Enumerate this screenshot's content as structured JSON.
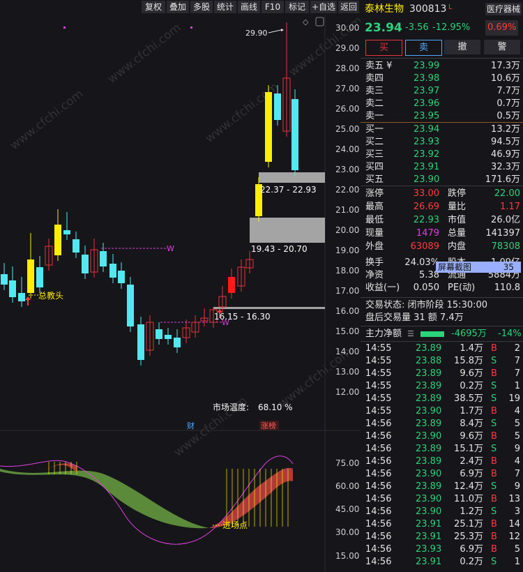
{
  "toolbar": {
    "items": [
      "复权",
      "叠加",
      "多股",
      "统计",
      "画线",
      "F10",
      "标记",
      "+自选",
      "返回"
    ]
  },
  "chart": {
    "yaxis": [
      "30.00",
      "29.00",
      "28.00",
      "27.00",
      "26.00",
      "25.00",
      "24.00",
      "23.00",
      "22.00",
      "21.00",
      "20.00",
      "19.00",
      "18.00",
      "17.00",
      "16.00",
      "15.00",
      "14.00",
      "13.00",
      "12.00"
    ],
    "annotations": {
      "high": "29.90",
      "total_buy": "总教头",
      "box1": "22.37 - 22.93",
      "box2": "19.43 - 20.70",
      "box3": "16.15 - 16.30",
      "w_label": "W",
      "temp_label": "市场温度:",
      "temp_value": "68.10 %",
      "cai": "财",
      "zhangbang": "涨榜",
      "entry": "进场点"
    },
    "ind_axis": [
      "75.00",
      "60.00",
      "45.00",
      "30.00",
      "15.00"
    ]
  },
  "watermark": "www.cfchi.com",
  "stock": {
    "name": "泰林生物",
    "code": "300813",
    "flag": "L",
    "sector": "医疗器械",
    "price": "23.94",
    "change": "-3.56",
    "pct": "-12.95%",
    "mkt_pct": "0.69%"
  },
  "buttons": {
    "buy": "买",
    "sell": "卖",
    "cancel": "撤",
    "alert": "警"
  },
  "ask": [
    {
      "label": "卖五 ¥",
      "price": "23.99",
      "vol": "17.3万"
    },
    {
      "label": "卖四",
      "price": "23.98",
      "vol": "10.6万"
    },
    {
      "label": "卖三",
      "price": "23.97",
      "vol": "7.7万"
    },
    {
      "label": "卖二",
      "price": "23.96",
      "vol": "0.7万"
    },
    {
      "label": "卖一",
      "price": "23.95",
      "vol": "0.5万"
    }
  ],
  "bid": [
    {
      "label": "买一",
      "price": "23.94",
      "vol": "13.2万"
    },
    {
      "label": "买二",
      "price": "23.93",
      "vol": "94.5万"
    },
    {
      "label": "买三",
      "price": "23.92",
      "vol": "46.9万"
    },
    {
      "label": "买四",
      "price": "23.91",
      "vol": "32.3万"
    },
    {
      "label": "买五",
      "price": "23.90",
      "vol": "171.6万"
    }
  ],
  "stats": {
    "zt_l": "涨停",
    "zt_v": "33.00",
    "dt_l": "跌停",
    "dt_v": "22.00",
    "hi_l": "最高",
    "hi_v": "26.69",
    "lb_l": "量比",
    "lb_v": "1.17",
    "lo_l": "最低",
    "lo_v": "22.93",
    "sz_l": "市值",
    "sz_v": "26.0亿",
    "xl_l": "现量",
    "xl_v": "1479",
    "zl_l": "总量",
    "zl_v": "141397",
    "wp_l": "外盘",
    "wp_v": "63089",
    "np_l": "内盘",
    "np_v": "78308",
    "hs_l": "换手",
    "hs_v": "24.03%",
    "gb_l": "股本",
    "gb_v": "1.09亿",
    "jz_l": "净资",
    "jz_v": "5.38",
    "lt_l": "流通",
    "lt_v": "5884万",
    "sy_l": "收益(一)",
    "sy_v": "0.050",
    "pe_l": "PE(动)",
    "pe_v": "110.8"
  },
  "screenshot_tip": {
    "label": "屏幕截图",
    "num": "35"
  },
  "status": {
    "line1": "交易状态: 闭市阶段 15:30:00",
    "line2": "盘后交易量 31 额 7.4万"
  },
  "mainflow": {
    "label": "主力净额",
    "value": "-4695万",
    "pct": "-14%"
  },
  "ticks": [
    {
      "t": "14:55",
      "p": "23.89",
      "v": "1.4万",
      "d": "B",
      "n": "2"
    },
    {
      "t": "14:55",
      "p": "23.88",
      "v": "15.8万",
      "d": "S",
      "n": "7"
    },
    {
      "t": "14:55",
      "p": "23.89",
      "v": "9.6万",
      "d": "B",
      "n": "7"
    },
    {
      "t": "14:55",
      "p": "23.89",
      "v": "0.2万",
      "d": "S",
      "n": "1"
    },
    {
      "t": "14:55",
      "p": "23.89",
      "v": "38.5万",
      "d": "S",
      "n": "19"
    },
    {
      "t": "14:55",
      "p": "23.90",
      "v": "1.7万",
      "d": "B",
      "n": "4"
    },
    {
      "t": "14:56",
      "p": "23.89",
      "v": "8.4万",
      "d": "S",
      "n": "5"
    },
    {
      "t": "14:56",
      "p": "23.90",
      "v": "9.6万",
      "d": "B",
      "n": "5"
    },
    {
      "t": "14:56",
      "p": "23.89",
      "v": "15.1万",
      "d": "S",
      "n": "9"
    },
    {
      "t": "14:56",
      "p": "23.89",
      "v": "2.4万",
      "d": "B",
      "n": "4"
    },
    {
      "t": "14:56",
      "p": "23.90",
      "v": "6.9万",
      "d": "B",
      "n": "7"
    },
    {
      "t": "14:56",
      "p": "23.89",
      "v": "12.4万",
      "d": "S",
      "n": "9"
    },
    {
      "t": "14:56",
      "p": "23.90",
      "v": "11.0万",
      "d": "B",
      "n": "13"
    },
    {
      "t": "14:56",
      "p": "23.90",
      "v": "1.2万",
      "d": "S",
      "n": "3"
    },
    {
      "t": "14:56",
      "p": "23.91",
      "v": "25.1万",
      "d": "B",
      "n": "14"
    },
    {
      "t": "14:56",
      "p": "23.91",
      "v": "25.3万",
      "d": "B",
      "n": "12"
    },
    {
      "t": "14:56",
      "p": "23.93",
      "v": "6.9万",
      "d": "B",
      "n": "5"
    },
    {
      "t": "14:56",
      "p": "23.91",
      "v": "0.2万",
      "d": "S",
      "n": "1"
    }
  ],
  "colors": {
    "up": "#e8343a",
    "down": "#2bd47a",
    "blue_candle": "#52e8f2",
    "yellow": "#ffee00",
    "accent_red": "#ff3b3b",
    "magenta": "#e040e0"
  }
}
